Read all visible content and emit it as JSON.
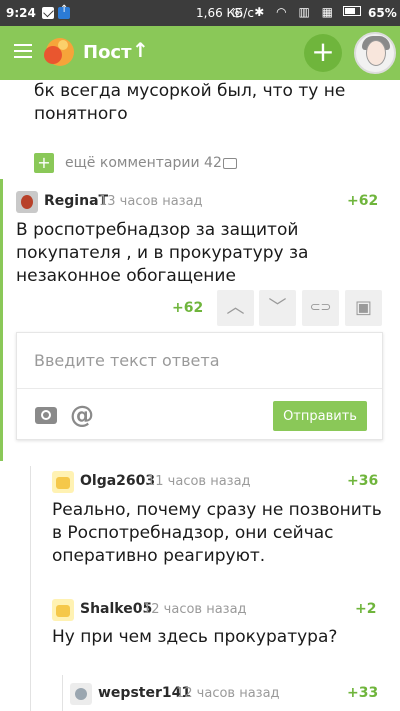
{
  "status": {
    "time": "9:24",
    "speed": "1,66 КБ/с",
    "icons": "◎ ✱ ◠ ▥ ▦",
    "battery": "65%"
  },
  "appbar": {
    "title": "Пост",
    "arrow": "↑",
    "add": "+"
  },
  "prev_comment": {
    "text": "бк всегда мусоркой был, что ту не понятного"
  },
  "more": {
    "plus": "+",
    "text": "ещё комментарии 42"
  },
  "comments": [
    {
      "user": "ReginaT",
      "time": "13 часов назад",
      "rating": "+62",
      "body": "В роспотребнадзор за защитой покупателя , и в прокуратуру за незаконное обогащение"
    },
    {
      "user": "Olga2603",
      "time": "11 часов назад",
      "rating": "+36",
      "body": "Реально, почему сразу не позвонить в Роспотребнадзор, они сейчас оперативно реагируют."
    },
    {
      "user": "Shalke05",
      "time": "12 часов назад",
      "rating": "+2",
      "body": "Ну при чем здесь прокуратура?"
    },
    {
      "user": "wepster141",
      "time": "12 часов назад",
      "rating": "+33",
      "body": ""
    }
  ],
  "vote": {
    "count": "+62",
    "up": "︿",
    "down": "﹀",
    "link": "⊂⊃",
    "save": "▣"
  },
  "reply": {
    "placeholder": "Введите текст ответа",
    "at": "@",
    "send": "Отправить"
  },
  "colors": {
    "accent": "#8ac858",
    "rating": "#6fb53c"
  }
}
